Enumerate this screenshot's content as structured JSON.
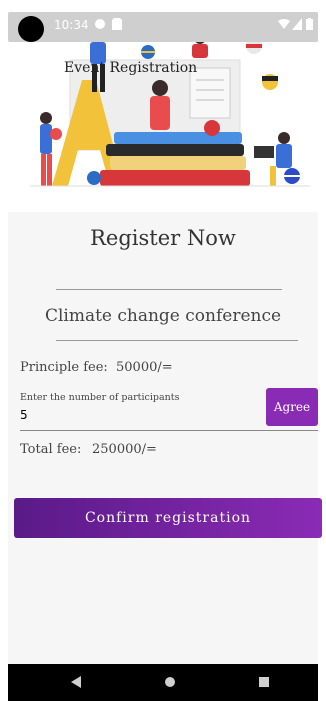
{
  "status_bar": {
    "time": "10:34"
  },
  "hero": {
    "title": "Event Registration"
  },
  "form": {
    "heading": "Register Now",
    "conference": "Climate change conference",
    "principle_fee_label": "Principle fee:",
    "principle_fee_value": "50000/=",
    "participants_label": "Enter the number of participants",
    "participants_value": "5",
    "agree_label": "Agree",
    "total_fee_label": "Total fee:",
    "total_fee_value": "250000/=",
    "confirm_label": "Confirm registration"
  },
  "colors": {
    "accent": "#8a2bb5",
    "accent_dark": "#5a1a88",
    "panel": "#f6f6f6"
  }
}
